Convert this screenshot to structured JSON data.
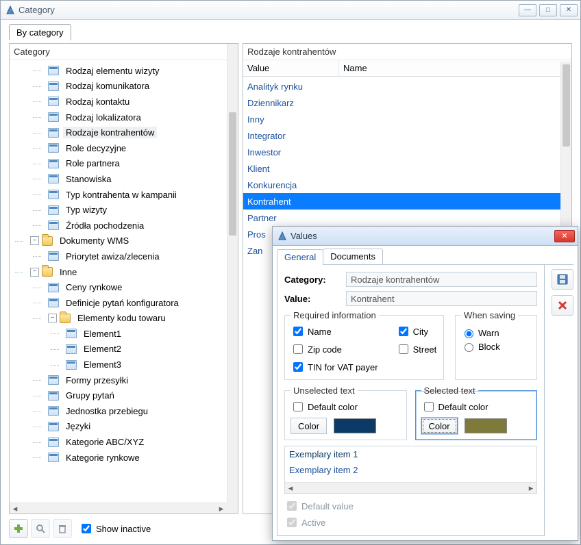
{
  "mainWindow": {
    "title": "Category"
  },
  "topTab": "By category",
  "leftPanel": {
    "header": "Category",
    "nodes": [
      {
        "indent": 56,
        "icon": "card",
        "label": "Rodzaj elementu wizyty"
      },
      {
        "indent": 56,
        "icon": "card",
        "label": "Rodzaj komunikatora"
      },
      {
        "indent": 56,
        "icon": "card",
        "label": "Rodzaj kontaktu"
      },
      {
        "indent": 56,
        "icon": "card",
        "label": "Rodzaj lokalizatora"
      },
      {
        "indent": 56,
        "icon": "card",
        "label": "Rodzaje kontrahentów",
        "selected": true
      },
      {
        "indent": 56,
        "icon": "card",
        "label": "Role decyzyjne"
      },
      {
        "indent": 56,
        "icon": "card",
        "label": "Role partnera"
      },
      {
        "indent": 56,
        "icon": "card",
        "label": "Stanowiska"
      },
      {
        "indent": 56,
        "icon": "card",
        "label": "Typ kontrahenta w kampanii"
      },
      {
        "indent": 56,
        "icon": "card",
        "label": "Typ wizyty"
      },
      {
        "indent": 56,
        "icon": "card",
        "label": "Źródła pochodzenia"
      },
      {
        "indent": 30,
        "icon": "folder",
        "label": "Dokumenty WMS",
        "exp": "-"
      },
      {
        "indent": 56,
        "icon": "card",
        "label": "Priorytet awiza/zlecenia"
      },
      {
        "indent": 30,
        "icon": "folder",
        "label": "Inne",
        "exp": "-"
      },
      {
        "indent": 56,
        "icon": "card",
        "label": "Ceny rynkowe"
      },
      {
        "indent": 56,
        "icon": "card",
        "label": "Definicje pytań konfiguratora"
      },
      {
        "indent": 56,
        "icon": "folder",
        "label": "Elementy kodu towaru",
        "exp": "-"
      },
      {
        "indent": 82,
        "icon": "card",
        "label": "Element1"
      },
      {
        "indent": 82,
        "icon": "card",
        "label": "Element2"
      },
      {
        "indent": 82,
        "icon": "card",
        "label": "Element3"
      },
      {
        "indent": 56,
        "icon": "card",
        "label": "Formy przesyłki"
      },
      {
        "indent": 56,
        "icon": "card",
        "label": "Grupy pytań"
      },
      {
        "indent": 56,
        "icon": "card",
        "label": "Jednostka przebiegu"
      },
      {
        "indent": 56,
        "icon": "card",
        "label": "Języki"
      },
      {
        "indent": 56,
        "icon": "card",
        "label": "Kategorie ABC/XYZ"
      },
      {
        "indent": 56,
        "icon": "card",
        "label": "Kategorie rynkowe"
      }
    ]
  },
  "rightPanel": {
    "header": "Rodzaje kontrahentów",
    "columns": {
      "value": "Value",
      "name": "Name"
    },
    "rows": [
      {
        "v": "Analityk rynku"
      },
      {
        "v": "Dziennikarz"
      },
      {
        "v": "Inny"
      },
      {
        "v": "Integrator"
      },
      {
        "v": "Inwestor"
      },
      {
        "v": "Klient"
      },
      {
        "v": "Konkurencja"
      },
      {
        "v": "Kontrahent",
        "selected": true
      },
      {
        "v": "Partner"
      },
      {
        "v": "Pros"
      },
      {
        "v": "Zan"
      }
    ]
  },
  "footer": {
    "showInactive": "Show inactive"
  },
  "dialog": {
    "title": "Values",
    "tabs": {
      "general": "General",
      "documents": "Documents"
    },
    "category": {
      "label": "Category:",
      "value": "Rodzaje kontrahentów"
    },
    "value": {
      "label": "Value:",
      "value": "Kontrahent"
    },
    "required": {
      "legend": "Required information",
      "name": "Name",
      "city": "City",
      "zip": "Zip code",
      "street": "Street",
      "tin": "TIN for VAT payer"
    },
    "saving": {
      "legend": "When saving",
      "warn": "Warn",
      "block": "Block"
    },
    "unselected": {
      "legend": "Unselected text",
      "default": "Default color",
      "colorBtn": "Color",
      "color": "#0b3a66"
    },
    "selected": {
      "legend": "Selected text",
      "default": "Default color",
      "colorBtn": "Color",
      "color": "#7e7a3a"
    },
    "exemplary": {
      "item1": "Exemplary item 1",
      "item2": "Exemplary item 2"
    },
    "defaultValue": "Default value",
    "active": "Active"
  }
}
